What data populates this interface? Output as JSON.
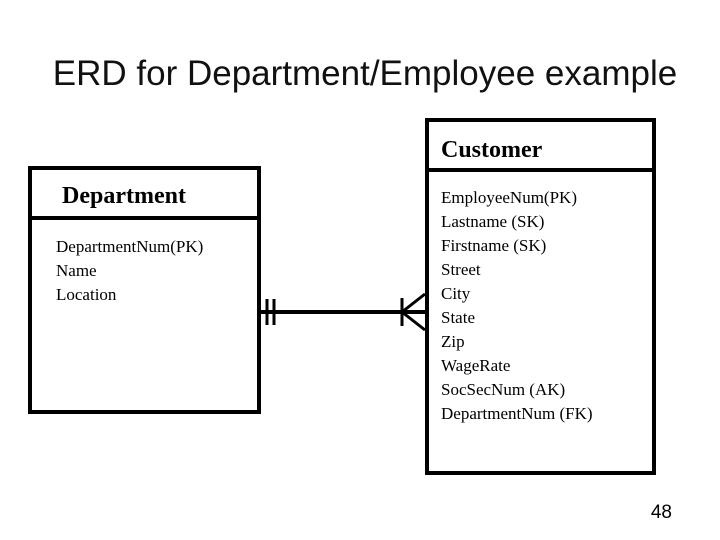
{
  "title": "ERD for Department/Employee example",
  "entities": {
    "department": {
      "name": "Department",
      "attributes": [
        "DepartmentNum(PK)",
        "Name",
        "Location"
      ]
    },
    "customer": {
      "name": "Customer",
      "attributes": [
        "EmployeeNum(PK)",
        "Lastname (SK)",
        "Firstname (SK)",
        "Street",
        "City",
        "State",
        "Zip",
        "WageRate",
        "SocSecNum (AK)",
        "DepartmentNum (FK)"
      ]
    }
  },
  "relationship": {
    "from": "Department",
    "to": "Customer",
    "from_cardinality": "one-and-only-one",
    "to_cardinality": "one-or-many"
  },
  "page_number": "48"
}
